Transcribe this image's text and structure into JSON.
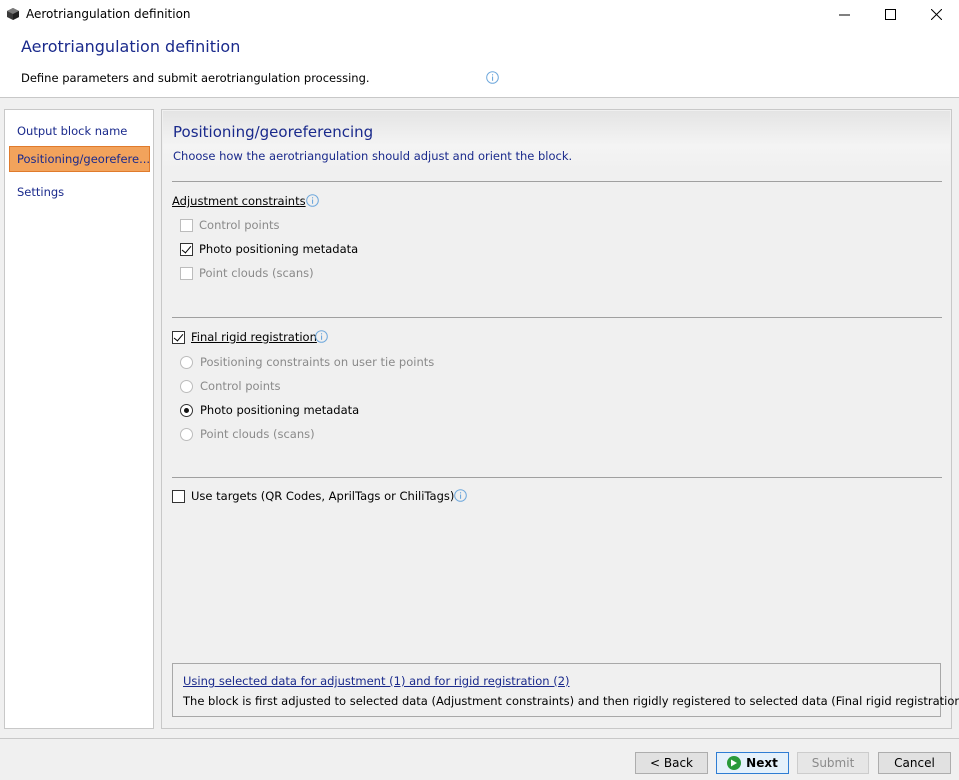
{
  "window": {
    "title": "Aerotriangulation definition",
    "minimize_glyph": "—",
    "maximize_glyph": "☐",
    "close_glyph": "✕"
  },
  "header": {
    "title": "Aerotriangulation definition",
    "subtitle": "Define parameters and submit aerotriangulation processing."
  },
  "sidebar": {
    "items": [
      {
        "label": "Output block name",
        "active": false
      },
      {
        "label": "Positioning/georefere...",
        "active": true
      },
      {
        "label": "Settings",
        "active": false
      }
    ]
  },
  "section": {
    "title": "Positioning/georeferencing",
    "description": "Choose how the aerotriangulation should adjust and orient the block."
  },
  "adjustment": {
    "label": "Adjustment constraints",
    "options": [
      {
        "label": "Control points",
        "checked": false,
        "enabled": false
      },
      {
        "label": "Photo positioning metadata",
        "checked": true,
        "enabled": true
      },
      {
        "label": "Point clouds (scans)",
        "checked": false,
        "enabled": false
      }
    ]
  },
  "rigid": {
    "label": "Final rigid registration",
    "checked": true,
    "options": [
      {
        "label": "Positioning constraints on user tie points",
        "selected": false,
        "enabled": false
      },
      {
        "label": "Control points",
        "selected": false,
        "enabled": false
      },
      {
        "label": "Photo positioning metadata",
        "selected": true,
        "enabled": true
      },
      {
        "label": "Point clouds (scans)",
        "selected": false,
        "enabled": false
      }
    ]
  },
  "targets": {
    "label": "Use targets (QR Codes, AprilTags or ChiliTags)",
    "checked": false
  },
  "note": {
    "title": "Using selected data for adjustment (1) and for rigid registration (2)",
    "body": "The block is first adjusted to selected data (Adjustment constraints) and then rigidly registered to selected data (Final rigid registration)."
  },
  "footer": {
    "back_label": "< Back",
    "next_label": "Next",
    "submit_label": "Submit",
    "cancel_label": "Cancel"
  },
  "colors": {
    "accent_text": "#1a2a8c",
    "active_nav": "#f2a35c",
    "info_icon": "#6fa8dc",
    "next_icon": "#2a9a3a"
  }
}
